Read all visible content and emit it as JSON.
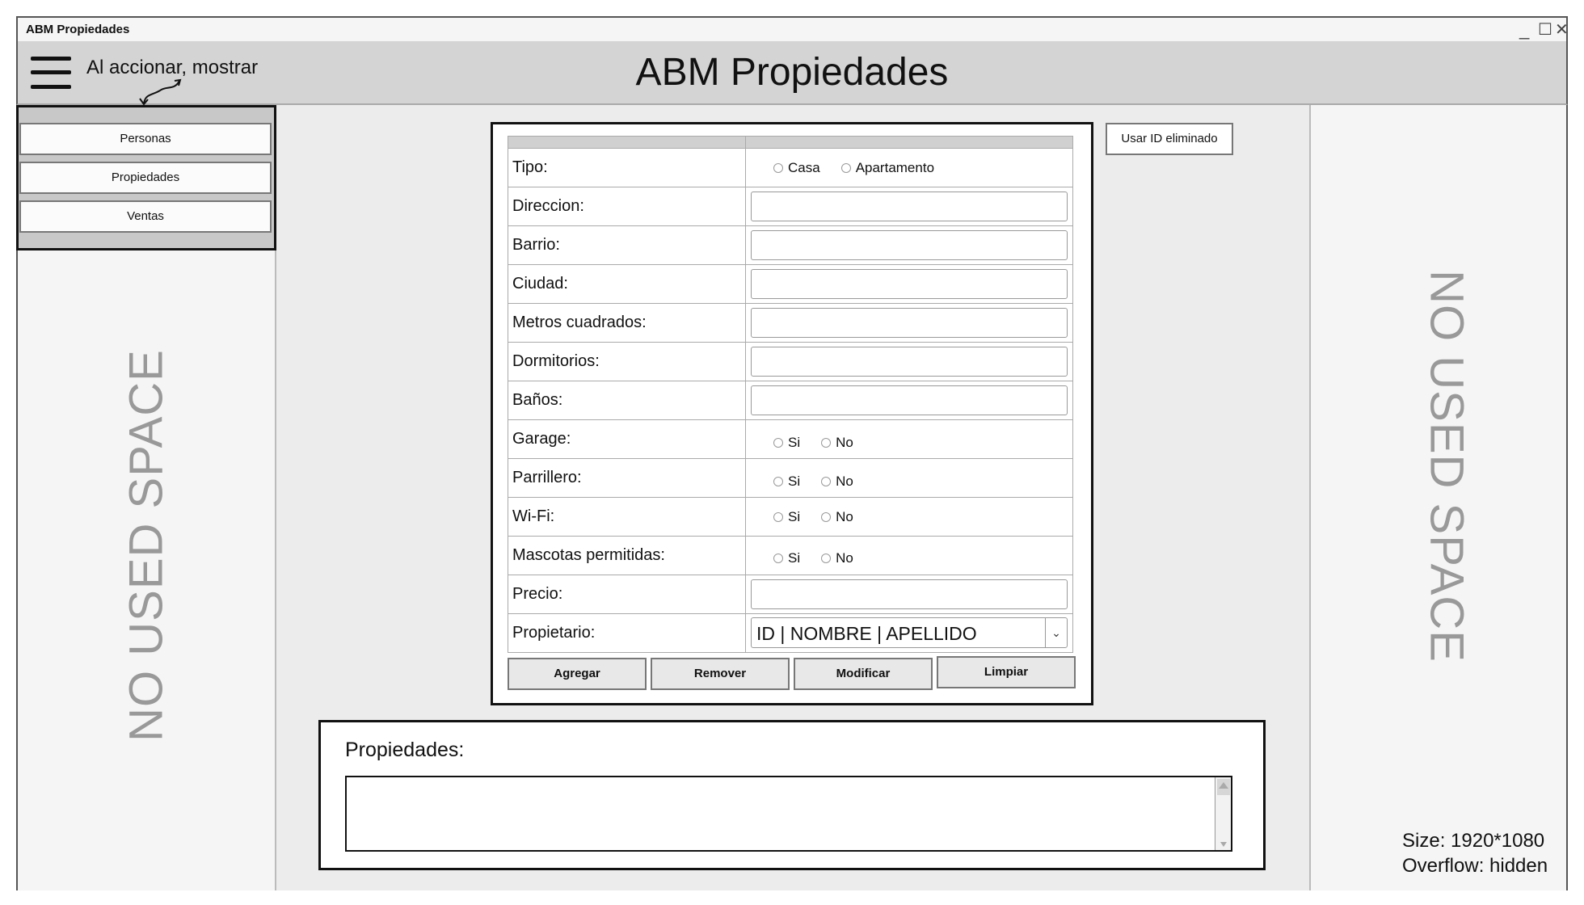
{
  "window": {
    "title": "ABM Propiedades",
    "controls": {
      "minimize": "_",
      "maximize": "☐",
      "close": "✕"
    }
  },
  "header": {
    "menu_annotation": "Al accionar, mostrar",
    "app_title": "ABM Propiedades"
  },
  "sidebar": {
    "items": [
      {
        "label": "Personas"
      },
      {
        "label": "Propiedades"
      },
      {
        "label": "Ventas"
      }
    ],
    "unused_label": "NO USED SPACE"
  },
  "right_panel": {
    "unused_label": "NO USED SPACE",
    "size_note": "Size: 1920*1080",
    "overflow_note": "Overflow: hidden"
  },
  "form": {
    "fields": {
      "tipo": {
        "label": "Tipo:",
        "options": [
          "Casa",
          "Apartamento"
        ]
      },
      "direccion": {
        "label": "Direccion:",
        "value": ""
      },
      "barrio": {
        "label": "Barrio:",
        "value": ""
      },
      "ciudad": {
        "label": "Ciudad:",
        "value": ""
      },
      "metros": {
        "label": "Metros cuadrados:",
        "value": ""
      },
      "dormitorios": {
        "label": "Dormitorios:",
        "value": ""
      },
      "banos": {
        "label": "Baños:",
        "value": ""
      },
      "garage": {
        "label": "Garage:",
        "options": [
          "Si",
          "No"
        ]
      },
      "parrillero": {
        "label": "Parrillero:",
        "options": [
          "Si",
          "No"
        ]
      },
      "wifi": {
        "label": "Wi-Fi:",
        "options": [
          "Si",
          "No"
        ]
      },
      "mascotas": {
        "label": "Mascotas permitidas:",
        "options": [
          "Si",
          "No"
        ]
      },
      "precio": {
        "label": "Precio:",
        "value": ""
      },
      "propietario": {
        "label": "Propietario:",
        "selected": "ID | NOMBRE | APELLIDO"
      }
    },
    "buttons": {
      "agregar": "Agregar",
      "remover": "Remover",
      "modificar": "Modificar",
      "limpiar": "Limpiar"
    },
    "usar_id": "Usar ID eliminado"
  },
  "list": {
    "label": "Propiedades:",
    "items": []
  }
}
